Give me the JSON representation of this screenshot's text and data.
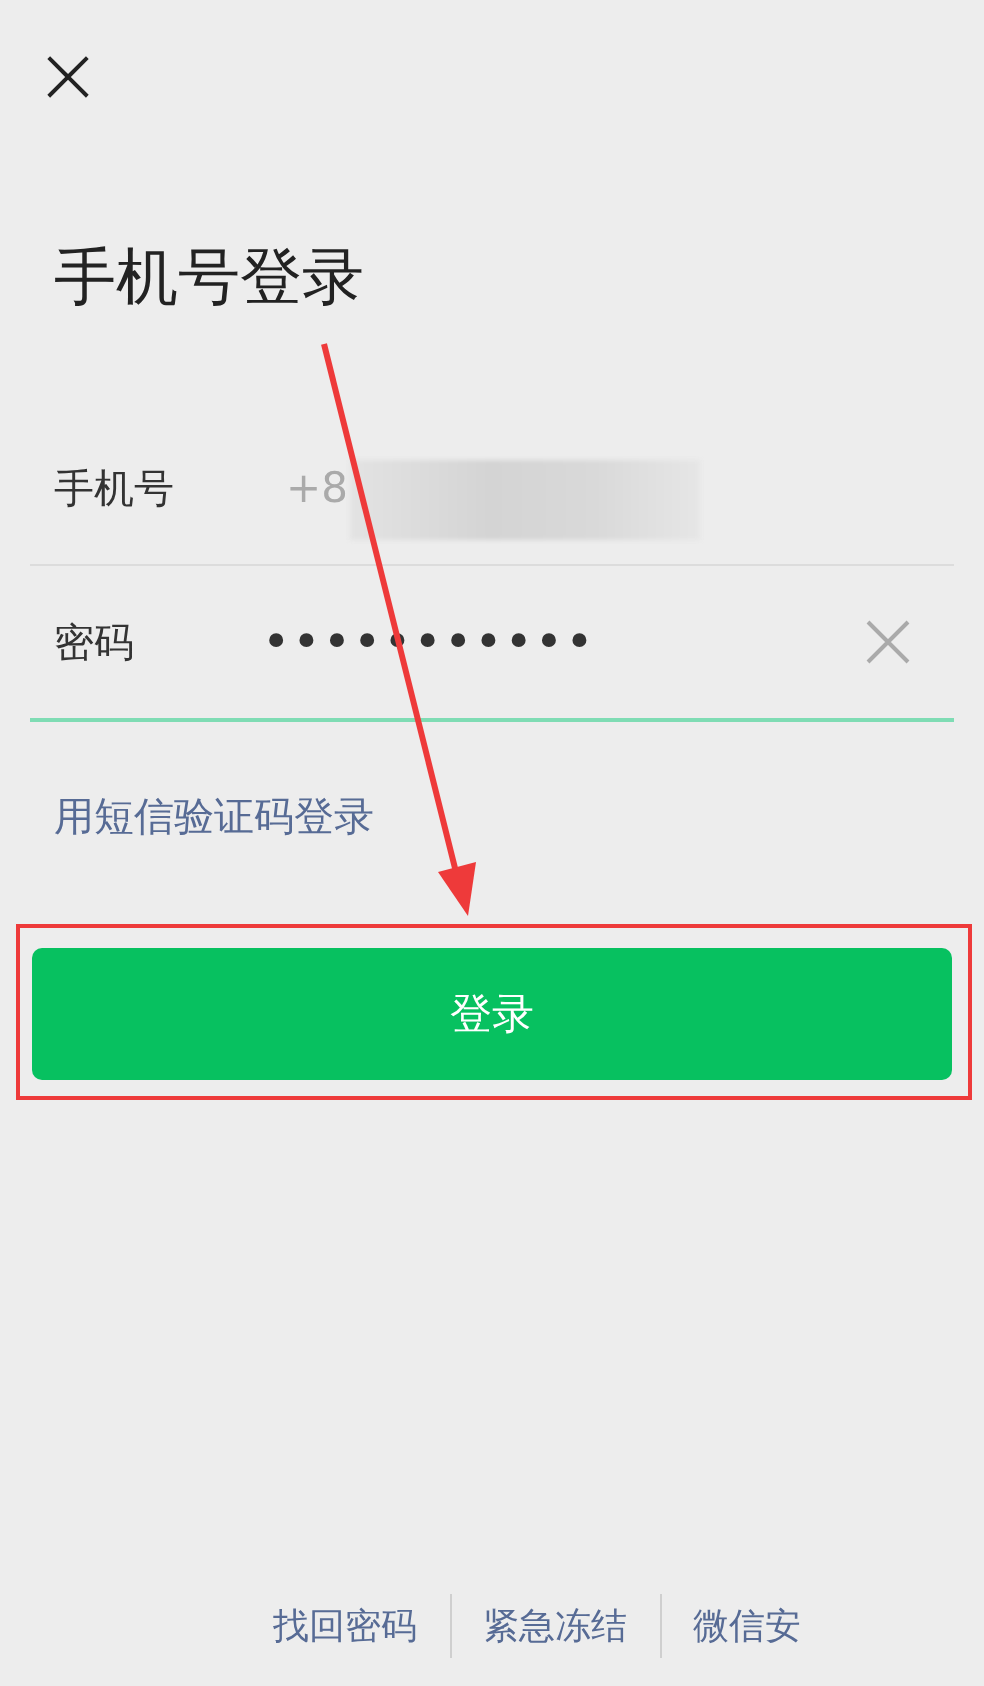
{
  "close_button": {
    "glyph": "×"
  },
  "title": "手机号登录",
  "form": {
    "fields": [
      {
        "kind": "phone",
        "label": "手机号",
        "value": "+8",
        "redacted": true,
        "clearable": false,
        "focused": false
      },
      {
        "kind": "password",
        "label": "密码",
        "value": "•••••••••••",
        "redacted": false,
        "clearable": true,
        "focused": true
      }
    ]
  },
  "sms_login_link": "用短信验证码登录",
  "login_button": {
    "label": "登录",
    "highlighted": true
  },
  "footer_links": [
    "找回密码",
    "紧急冻结",
    "微信安"
  ]
}
